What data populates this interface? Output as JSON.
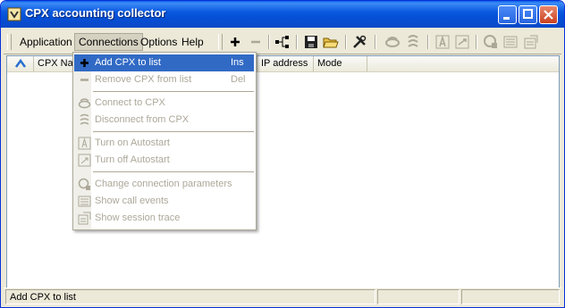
{
  "window": {
    "title": "CPX accounting collector"
  },
  "menubar": [
    {
      "label": "Application"
    },
    {
      "label": "Connections"
    },
    {
      "label": "Options"
    },
    {
      "label": "Help"
    }
  ],
  "toolbar": [
    {
      "icon": "plus-icon"
    },
    {
      "icon": "minus-icon"
    },
    {
      "icon": "network-tree-icon"
    },
    {
      "icon": "save-icon"
    },
    {
      "icon": "open-folder-icon"
    },
    {
      "icon": "tools-icon"
    },
    {
      "icon": "connect-icon"
    },
    {
      "icon": "disconnect-icon"
    },
    {
      "icon": "autostart-on-icon"
    },
    {
      "icon": "autostart-off-icon"
    },
    {
      "icon": "connection-params-icon"
    },
    {
      "icon": "call-events-icon"
    },
    {
      "icon": "session-trace-icon"
    }
  ],
  "list": {
    "columns": [
      "CPX Na",
      "IP address",
      "Mode"
    ]
  },
  "connections_menu": [
    {
      "label": "Add CPX to list",
      "shortcut": "Ins",
      "state": "highlighted",
      "icon": "plus-icon"
    },
    {
      "label": "Remove CPX from list",
      "shortcut": "Del",
      "state": "disabled",
      "icon": "minus-icon"
    },
    {
      "label": "Connect to CPX",
      "shortcut": "",
      "state": "disabled",
      "icon": "connect-icon"
    },
    {
      "label": "Disconnect from CPX",
      "shortcut": "",
      "state": "disabled",
      "icon": "disconnect-icon"
    },
    {
      "label": "Turn on Autostart",
      "shortcut": "",
      "state": "disabled",
      "icon": "autostart-on-icon"
    },
    {
      "label": "Turn off Autostart",
      "shortcut": "",
      "state": "disabled",
      "icon": "autostart-off-icon"
    },
    {
      "label": "Change connection parameters",
      "shortcut": "",
      "state": "disabled",
      "icon": "connection-params-icon"
    },
    {
      "label": "Show call events",
      "shortcut": "",
      "state": "disabled",
      "icon": "call-events-icon"
    },
    {
      "label": "Show session trace",
      "shortcut": "",
      "state": "disabled",
      "icon": "session-trace-icon"
    }
  ],
  "statusbar": {
    "text": "Add CPX to list"
  },
  "colors": {
    "title_blue": "#0a5fe8",
    "highlight": "#316ac5",
    "disabled_text": "#aca899",
    "face": "#ece9d8"
  }
}
